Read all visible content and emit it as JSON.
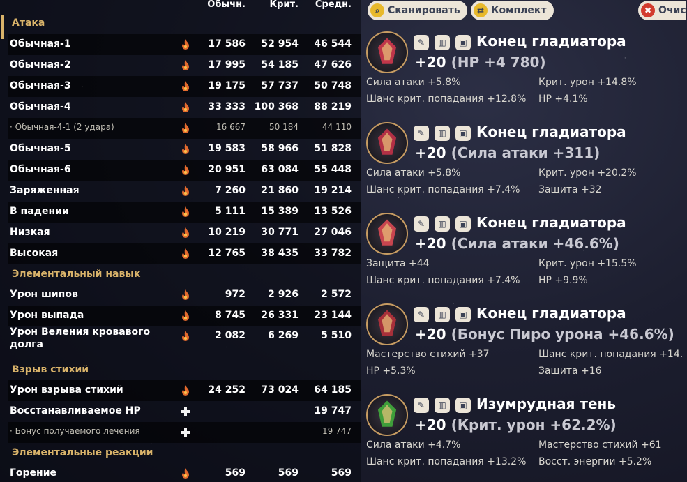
{
  "headers": {
    "normal": "Обычн.",
    "crit": "Крит.",
    "avg": "Средн."
  },
  "sections": {
    "attack": "Атака",
    "skill": "Элементальный навык",
    "burst": "Взрыв стихий",
    "reactions": "Элементальные реакции"
  },
  "rows": [
    {
      "label": "Обычная-1",
      "icon": "pyro-icon",
      "normal": "17 586",
      "crit": "52 954",
      "avg": "46 544"
    },
    {
      "label": "Обычная-2",
      "icon": "pyro-icon",
      "normal": "17 995",
      "crit": "54 185",
      "avg": "47 626"
    },
    {
      "label": "Обычная-3",
      "icon": "pyro-icon",
      "normal": "19 175",
      "crit": "57 737",
      "avg": "50 748"
    },
    {
      "label": "Обычная-4",
      "icon": "pyro-icon",
      "normal": "33 333",
      "crit": "100 368",
      "avg": "88 219"
    },
    {
      "label": "· Обычная-4-1 (2 удара)",
      "icon": "pyro-icon",
      "normal": "16 667",
      "crit": "50 184",
      "avg": "44 110"
    },
    {
      "label": "Обычная-5",
      "icon": "pyro-icon",
      "normal": "19 583",
      "crit": "58 966",
      "avg": "51 828"
    },
    {
      "label": "Обычная-6",
      "icon": "pyro-icon",
      "normal": "20 951",
      "crit": "63 084",
      "avg": "55 448"
    },
    {
      "label": "Заряженная",
      "icon": "pyro-icon",
      "normal": "7 260",
      "crit": "21 860",
      "avg": "19 214"
    },
    {
      "label": "В падении",
      "icon": "pyro-icon",
      "normal": "5 111",
      "crit": "15 389",
      "avg": "13 526"
    },
    {
      "label": "Низкая",
      "icon": "pyro-icon",
      "normal": "10 219",
      "crit": "30 771",
      "avg": "27 046"
    },
    {
      "label": "Высокая",
      "icon": "pyro-icon",
      "normal": "12 765",
      "crit": "38 435",
      "avg": "33 782"
    },
    {
      "label": "Урон шипов",
      "icon": "pyro-icon",
      "normal": "972",
      "crit": "2 926",
      "avg": "2 572"
    },
    {
      "label": "Урон выпада",
      "icon": "pyro-icon",
      "normal": "8 745",
      "crit": "26 331",
      "avg": "23 144"
    },
    {
      "label": "Урон Веления кровавого долга",
      "icon": "pyro-icon",
      "normal": "2 082",
      "crit": "6 269",
      "avg": "5 510"
    },
    {
      "label": "Урон взрыва стихий",
      "icon": "pyro-icon",
      "normal": "24 252",
      "crit": "73 024",
      "avg": "64 185"
    },
    {
      "label": "Восстанавливаемое HP",
      "icon": "heal-icon",
      "normal": "",
      "crit": "",
      "avg": "19 747"
    },
    {
      "label": "· Бонус получаемого лечения",
      "icon": "heal-icon",
      "normal": "",
      "crit": "",
      "avg": "19 747"
    },
    {
      "label": "Горение",
      "icon": "pyro-icon",
      "normal": "569",
      "crit": "569",
      "avg": "569"
    }
  ],
  "toolbar": {
    "scan": "Сканировать",
    "set": "Комплект",
    "clear": "Очис"
  },
  "artifacts": [
    {
      "name": "Конец гладиатора",
      "level": "+20",
      "main": "(HP +4 780)",
      "subs": [
        "Сила атаки +5.8%",
        "Крит. урон +14.8%",
        "Шанс крит. попадания +12.8%",
        "HP +4.1%"
      ]
    },
    {
      "name": "Конец гладиатора",
      "level": "+20",
      "main": "(Сила атаки +311)",
      "subs": [
        "Сила атаки +5.8%",
        "Крит. урон +20.2%",
        "Шанс крит. попадания +7.4%",
        "Защита +32"
      ]
    },
    {
      "name": "Конец гладиатора",
      "level": "+20",
      "main": "(Сила атаки +46.6%)",
      "subs": [
        "Защита +44",
        "Крит. урон +15.5%",
        "Шанс крит. попадания +7.4%",
        "HP +9.9%"
      ]
    },
    {
      "name": "Конец гладиатора",
      "level": "+20",
      "main": "(Бонус Пиро урона +46.6%)",
      "subs": [
        "Мастерство стихий +37",
        "Шанс крит. попадания +14.",
        "HP +5.3%",
        "Защита +16"
      ]
    },
    {
      "name": "Изумрудная тень",
      "level": "+20",
      "main": "(Крит. урон +62.2%)",
      "subs": [
        "Сила атаки +4.7%",
        "Мастерство стихий +61",
        "Шанс крит. попадания +13.2%",
        "Восст. энергии +5.2%"
      ]
    }
  ],
  "colors": {
    "accent": "#d9b36a",
    "pyro": "#e36a2e",
    "button_bg": "#ece5d8",
    "button_text": "#3b4255",
    "scan": "#e8b92b",
    "set": "#e8b92b",
    "clear": "#d23b2e"
  }
}
